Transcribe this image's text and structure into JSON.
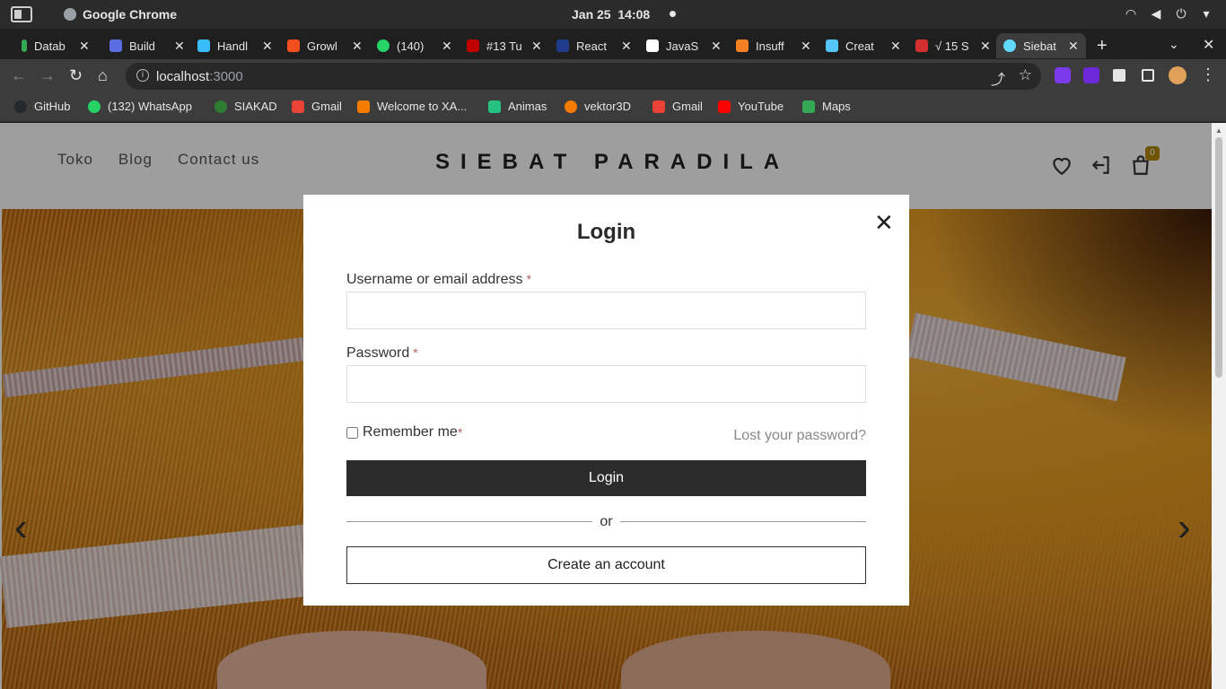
{
  "os": {
    "app_name": "Google Chrome",
    "date": "Jan 25",
    "time": "14:08"
  },
  "tabs": [
    {
      "label": "Datab",
      "color": "#34a853"
    },
    {
      "label": "Build",
      "color": "#5b6ee1"
    },
    {
      "label": "Handl",
      "color": "#38bdf8"
    },
    {
      "label": "Growl",
      "color": "#f24e1e"
    },
    {
      "label": "(140)",
      "color": "#25d366"
    },
    {
      "label": "#13 Tu",
      "color": "#c00000"
    },
    {
      "label": "React",
      "color": "#1f3b8a"
    },
    {
      "label": "JavaS",
      "color": "#ffffff"
    },
    {
      "label": "Insuff",
      "color": "#f48024"
    },
    {
      "label": "Creat",
      "color": "#54c5f8"
    },
    {
      "label": "√ 15 S",
      "color": "#d32f2f"
    },
    {
      "label": "Siebat",
      "color": "#61dafb"
    }
  ],
  "address": {
    "host": "localhost",
    "port": ":3000"
  },
  "bookmarks": [
    {
      "label": "GitHub",
      "color": "#24292e"
    },
    {
      "label": "(132) WhatsApp",
      "color": "#25d366"
    },
    {
      "label": "SIAKAD",
      "color": "#2e7d32"
    },
    {
      "label": "Gmail",
      "color": "#ea4335"
    },
    {
      "label": "Welcome to XA...",
      "color": "#f57c00"
    },
    {
      "label": "Animas",
      "color": "#26c281"
    },
    {
      "label": "vektor3D",
      "color": "#f57c00"
    },
    {
      "label": "Gmail",
      "color": "#ea4335"
    },
    {
      "label": "YouTube",
      "color": "#ff0000"
    },
    {
      "label": "Maps",
      "color": "#34a853"
    }
  ],
  "site": {
    "nav": [
      "Toko",
      "Blog",
      "Contact us"
    ],
    "brand": "SIEBAT PARADILA",
    "cart_count": "0"
  },
  "login": {
    "title": "Login",
    "username_label": "Username or email address",
    "password_label": "Password",
    "required_mark": "*",
    "remember_label": "Remember me",
    "lost_password": "Lost your password?",
    "login_button": "Login",
    "divider": "or",
    "create_account": "Create an account"
  }
}
